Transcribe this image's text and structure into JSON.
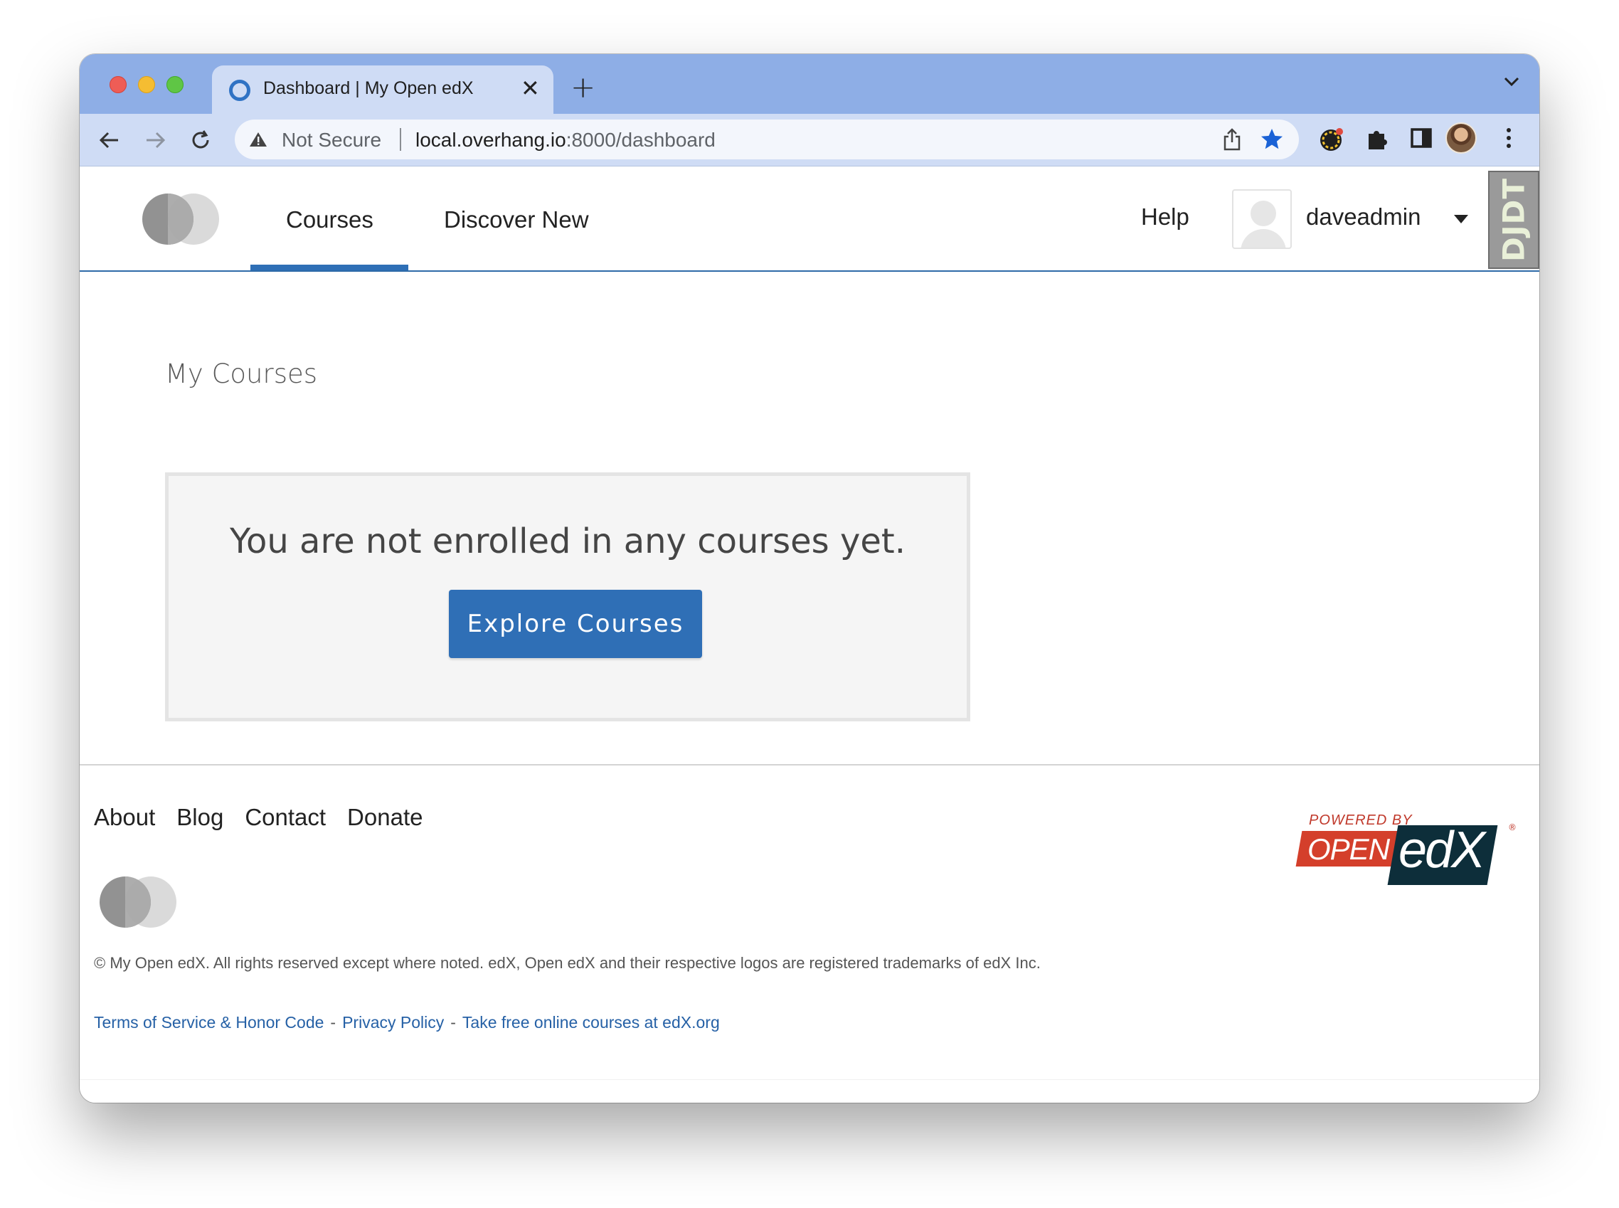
{
  "browser": {
    "tab_title": "Dashboard | My Open edX",
    "security_label": "Not Secure",
    "url_host": "local.overhang.io",
    "url_path": ":8000/dashboard"
  },
  "header": {
    "nav": [
      {
        "label": "Courses",
        "active": true
      },
      {
        "label": "Discover New",
        "active": false
      }
    ],
    "help_label": "Help",
    "username": "daveadmin",
    "debug_toolbar_label": "DJDT"
  },
  "main": {
    "section_title": "My Courses",
    "empty_message": "You are not enrolled in any courses yet.",
    "explore_button": "Explore Courses"
  },
  "footer": {
    "links": [
      "About",
      "Blog",
      "Contact",
      "Donate"
    ],
    "copyright": "© My Open edX. All rights reserved except where noted. edX, Open edX and their respective logos are registered trademarks of edX Inc.",
    "legal_links": [
      "Terms of Service & Honor Code",
      "Privacy Policy",
      "Take free online courses at edX.org"
    ],
    "powered_by": "POWERED BY",
    "brand_open": "OPEN",
    "brand_edx": "edX",
    "brand_registered": "®"
  },
  "colors": {
    "accent": "#2f6fb6",
    "link": "#2661a6",
    "tab_strip": "#8eaee6",
    "toolbar": "#cfdcf5"
  },
  "icons": [
    "favicon-icon",
    "close-icon",
    "plus-icon",
    "chevron-down-icon",
    "back-icon",
    "forward-icon",
    "reload-icon",
    "warning-icon",
    "share-icon",
    "star-icon",
    "extension-icon",
    "puzzle-icon",
    "sidebar-icon",
    "profile-avatar",
    "kebab-menu-icon",
    "caret-down-icon"
  ]
}
